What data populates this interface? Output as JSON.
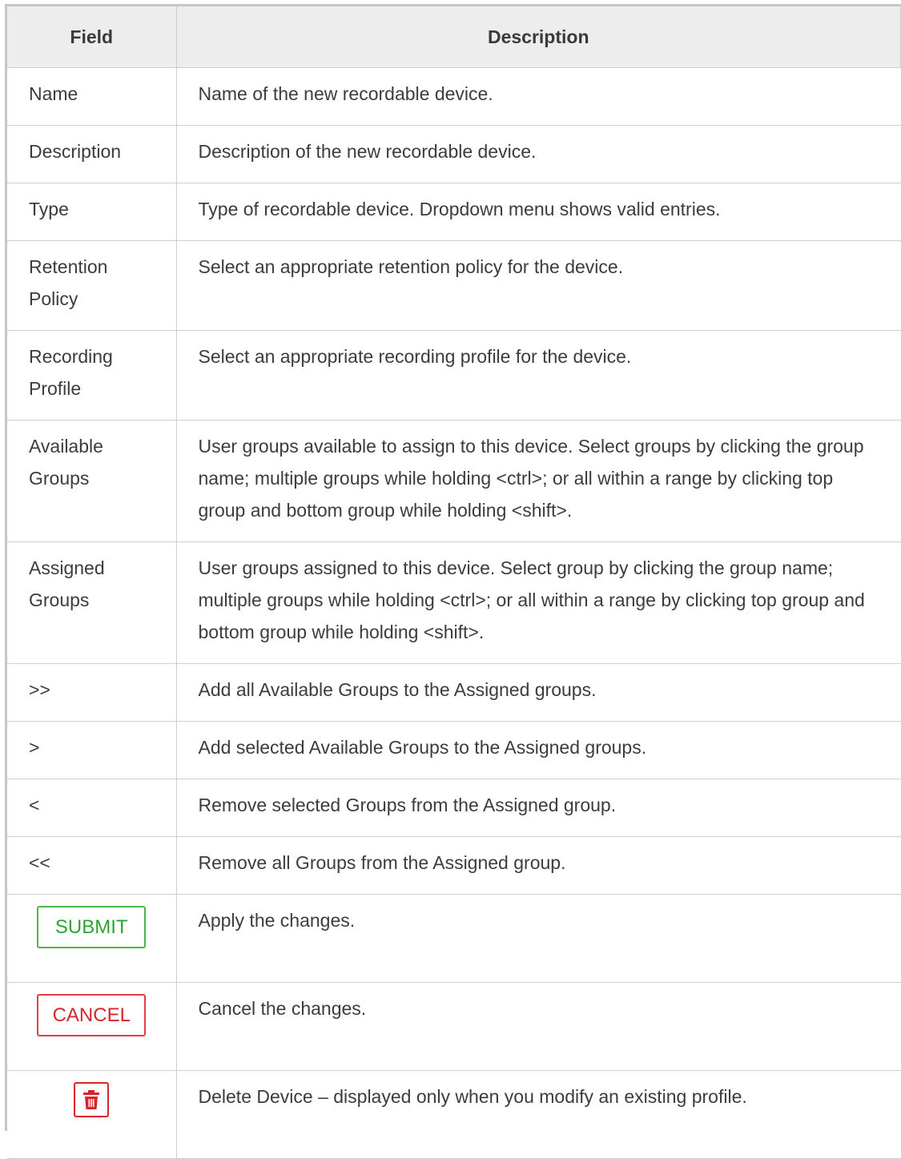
{
  "header": {
    "field": "Field",
    "description": "Description"
  },
  "rows": [
    {
      "field": "Name",
      "description": "Name of the new recordable device."
    },
    {
      "field": "Description",
      "description": "Description of the new recordable device."
    },
    {
      "field": "Type",
      "description": "Type of recordable device. Dropdown menu shows valid entries."
    },
    {
      "field": "Retention Policy",
      "description": "Select an appropriate retention policy for the device."
    },
    {
      "field": "Recording Profile",
      "description": "Select an appropriate recording profile for the device."
    },
    {
      "field": "Available Groups",
      "description": "User groups available to assign to this device. Select groups by clicking the group name; multiple groups while holding <ctrl>; or all within a range by clicking top group and bottom group while holding <shift>."
    },
    {
      "field": "Assigned Groups",
      "description": "User groups assigned to this device. Select group by clicking the group name; multiple groups while holding <ctrl>; or all within a range by clicking top group and bottom group while holding <shift>."
    },
    {
      "field": ">>",
      "description": "Add all Available Groups to the Assigned groups."
    },
    {
      "field": ">",
      "description": "Add selected Available Groups to the Assigned groups."
    },
    {
      "field": "<",
      "description": "Remove selected Groups from the Assigned group."
    },
    {
      "field": "<<",
      "description": "Remove all Groups from the Assigned group."
    }
  ],
  "button_rows": [
    {
      "label": "SUBMIT",
      "description": "Apply the changes."
    },
    {
      "label": "CANCEL",
      "description": "Cancel the changes."
    },
    {
      "icon": "trash-icon",
      "description": "Delete Device – displayed only when you modify an existing profile."
    }
  ],
  "colors": {
    "submit": "#2fa32f",
    "cancel": "#d6262b",
    "header_bg": "#ededed"
  }
}
